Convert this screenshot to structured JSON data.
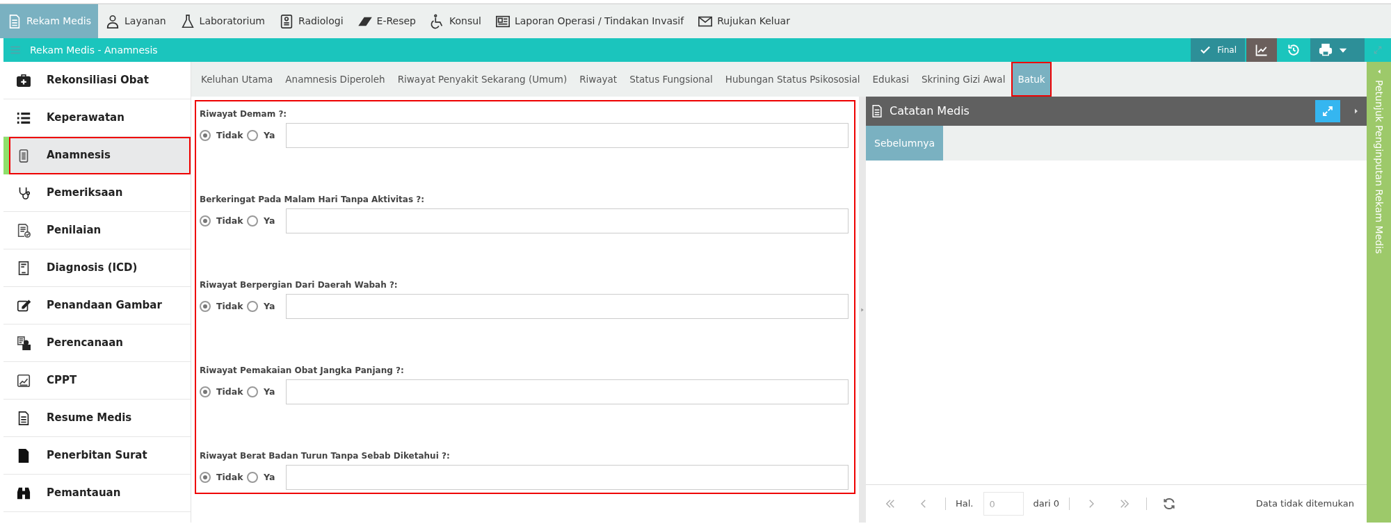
{
  "top_menu": [
    {
      "label": "Rekam Medis",
      "selected": true
    },
    {
      "label": "Layanan",
      "selected": false
    },
    {
      "label": "Laboratorium",
      "selected": false
    },
    {
      "label": "Radiologi",
      "selected": false
    },
    {
      "label": "E-Resep",
      "selected": false
    },
    {
      "label": "Konsul",
      "selected": false
    },
    {
      "label": "Laporan Operasi / Tindakan Invasif",
      "selected": false
    },
    {
      "label": "Rujukan Keluar",
      "selected": false
    }
  ],
  "header": {
    "title": "Rekam Medis - Anamnesis",
    "final_button": "Final"
  },
  "sidebar": {
    "items": [
      {
        "label": "Rekonsiliasi Obat",
        "selected": false
      },
      {
        "label": "Keperawatan",
        "selected": false
      },
      {
        "label": "Anamnesis",
        "selected": true
      },
      {
        "label": "Pemeriksaan",
        "selected": false
      },
      {
        "label": "Penilaian",
        "selected": false
      },
      {
        "label": "Diagnosis (ICD)",
        "selected": false
      },
      {
        "label": "Penandaan Gambar",
        "selected": false
      },
      {
        "label": "Perencanaan",
        "selected": false
      },
      {
        "label": "CPPT",
        "selected": false
      },
      {
        "label": "Resume Medis",
        "selected": false
      },
      {
        "label": "Penerbitan Surat",
        "selected": false
      },
      {
        "label": "Pemantauan",
        "selected": false
      }
    ]
  },
  "tabs": [
    {
      "label": "Keluhan Utama",
      "selected": false
    },
    {
      "label": "Anamnesis Diperoleh",
      "selected": false
    },
    {
      "label": "Riwayat Penyakit Sekarang (Umum)",
      "selected": false
    },
    {
      "label": "Riwayat",
      "selected": false
    },
    {
      "label": "Status Fungsional",
      "selected": false
    },
    {
      "label": "Hubungan Status Psikososial",
      "selected": false
    },
    {
      "label": "Edukasi",
      "selected": false
    },
    {
      "label": "Skrining Gizi Awal",
      "selected": false
    },
    {
      "label": "Batuk",
      "selected": true
    }
  ],
  "questions": [
    {
      "label": "Riwayat Demam ?:",
      "options": [
        {
          "label": "Tidak",
          "selected": true
        },
        {
          "label": "Ya",
          "selected": false
        }
      ]
    },
    {
      "label": "Berkeringat Pada Malam Hari Tanpa Aktivitas ?:",
      "options": [
        {
          "label": "Tidak",
          "selected": true
        },
        {
          "label": "Ya",
          "selected": false
        }
      ]
    },
    {
      "label": "Riwayat Berpergian Dari Daerah Wabah ?:",
      "options": [
        {
          "label": "Tidak",
          "selected": true
        },
        {
          "label": "Ya",
          "selected": false
        }
      ]
    },
    {
      "label": "Riwayat Pemakaian Obat Jangka Panjang ?:",
      "options": [
        {
          "label": "Tidak",
          "selected": true
        },
        {
          "label": "Ya",
          "selected": false
        }
      ]
    },
    {
      "label": "Riwayat Berat Badan Turun Tanpa Sebab Diketahui ?:",
      "options": [
        {
          "label": "Tidak",
          "selected": true
        },
        {
          "label": "Ya",
          "selected": false
        }
      ]
    }
  ],
  "notes_panel": {
    "title": "Catatan Medis",
    "subtabs": [
      {
        "label": "Sebelumnya",
        "selected": true
      }
    ],
    "pager": {
      "page_label": "Hal.",
      "page_value": "0",
      "of_label": "dari 0",
      "status": "Data tidak ditemukan"
    }
  },
  "side_strip": {
    "label": "Petunjuk Penginputan Rekam Medis"
  }
}
